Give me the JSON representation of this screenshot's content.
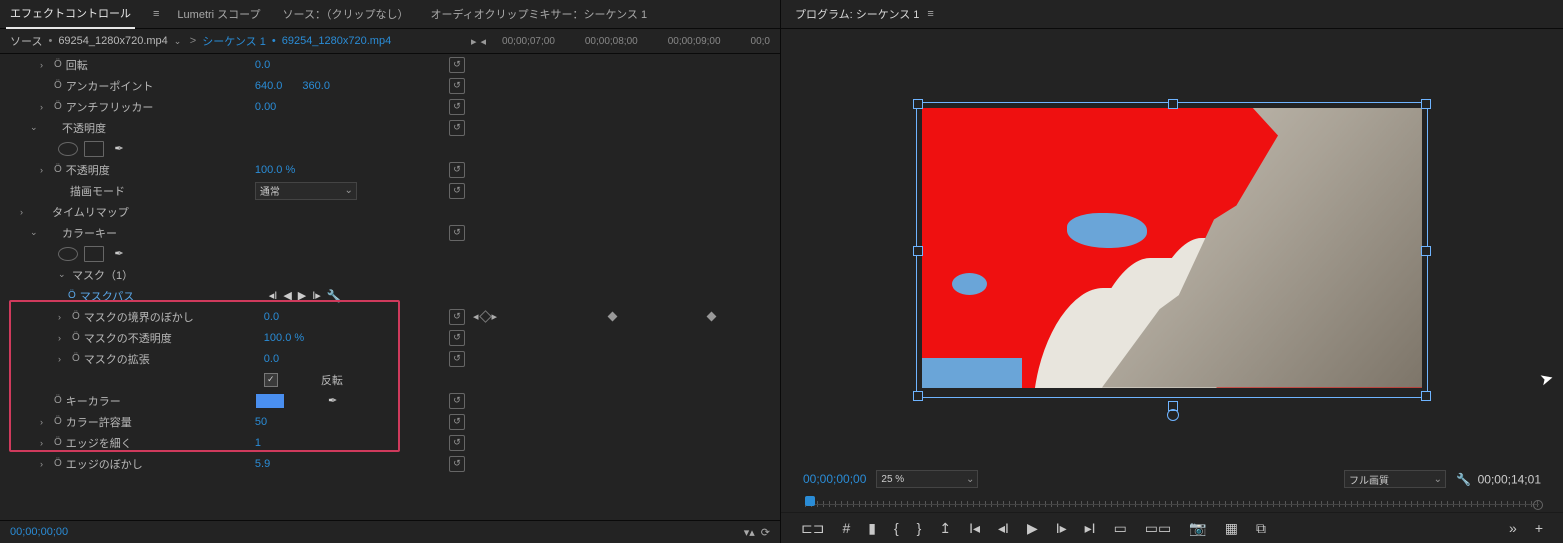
{
  "tabs": {
    "effect_controls": "エフェクトコントロール",
    "lumetri": "Lumetri スコープ",
    "source": "ソース：（クリップなし）",
    "audio_mixer": "オーディオクリップミキサー：シーケンス 1"
  },
  "source_row": {
    "source_prefix": "ソース",
    "source_name": "69254_1280x720.mp4",
    "seq_prefix": "シーケンス 1",
    "clip_name": "69254_1280x720.mp4"
  },
  "time_ruler": [
    "00;00;07;00",
    "00;00;08;00",
    "00;00;09;00",
    "00;0"
  ],
  "props": {
    "rotation": {
      "label": "回転",
      "value": "0.0"
    },
    "anchor": {
      "label": "アンカーポイント",
      "v1": "640.0",
      "v2": "360.0"
    },
    "antiflicker": {
      "label": "アンチフリッカー",
      "value": "0.00"
    },
    "opacity_effect": "不透明度",
    "opacity": {
      "label": "不透明度",
      "value": "100.0 %"
    },
    "blend_mode": {
      "label": "描画モード",
      "value": "通常"
    },
    "time_remap": "タイムリマップ",
    "color_key": "カラーキー",
    "mask": "マスク（1）",
    "mask_path": "マスクパス",
    "mask_feather": {
      "label": "マスクの境界のぼかし",
      "value": "0.0"
    },
    "mask_opacity": {
      "label": "マスクの不透明度",
      "value": "100.0 %"
    },
    "mask_expand": {
      "label": "マスクの拡張",
      "value": "0.0"
    },
    "mask_invert": "反転",
    "key_color": "キーカラー",
    "color_tolerance": {
      "label": "カラー許容量",
      "value": "50"
    },
    "edge_thin": {
      "label": "エッジを細く",
      "value": "1"
    },
    "edge_feather": {
      "label": "エッジのぼかし",
      "value": "5.9"
    }
  },
  "bottom_tc": "00;00;00;00",
  "program": {
    "title": "プログラム: シーケンス 1",
    "tc_left": "00;00;00;00",
    "zoom": "25 %",
    "quality": "フル画質",
    "tc_right": "00;00;14;01"
  }
}
